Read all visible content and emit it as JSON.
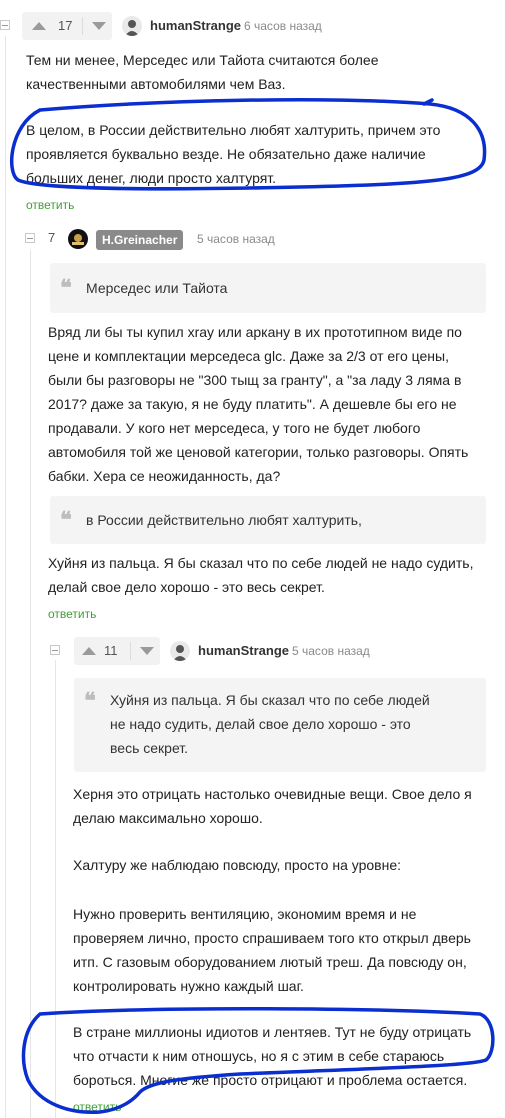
{
  "comment1": {
    "votes": "17",
    "username": "humanStrange",
    "time": "6 часов назад",
    "para1_l1": "Тем ни менее, Мерседес или Тайота считаются более",
    "para1_l2": "качественными автомобилями чем Ваз.",
    "para2_l1": "В целом, в России действительно любят халтурить, причем это",
    "para2_l2": "проявляется буквально везде. Не обязательно даже наличие",
    "para2_l3": "больших денег, люди просто халтурят.",
    "reply": "ответить"
  },
  "comment2": {
    "votes": "7",
    "username": "H.Greinacher",
    "time": "5 часов назад",
    "quote1": "Мерседес или Тайота",
    "body_l1": "Вряд ли бы ты купил xray или аркану в их прототипном виде по",
    "body_l2": "цене и комплектации мерседеса glc. Даже за 2/3 от его цены,",
    "body_l3": "были бы разговоры не \"300 тыщ за гранту\", а \"за ладу 3 ляма в",
    "body_l4": "2017? даже за такую, я не буду платить\". А дешевле бы его не",
    "body_l5": "продавали. У кого нет мерседеса, у того не будет любого",
    "body_l6": "автомобиля той же ценовой категории, только разговоры. Опять",
    "body_l7": "бабки. Хера се неожиданность, да?",
    "quote2": "в России действительно любят халтурить,",
    "tail_l1": "Хуйня из пальца. Я бы сказал что по себе людей не надо судить,",
    "tail_l2": "делай свое дело хорошо - это весь секрет.",
    "reply": "ответить"
  },
  "comment3": {
    "votes": "11",
    "username": "humanStrange",
    "time": "5 часов назад",
    "quote_l1": "Хуйня из пальца. Я бы сказал что по себе людей",
    "quote_l2": "не надо судить, делай свое дело хорошо - это",
    "quote_l3": "весь секрет.",
    "p1_l1": "Херня это отрицать настолько очевидные вещи. Свое дело я",
    "p1_l2": "делаю максимально хорошо.",
    "p2_l1": "Халтуру же наблюдаю повсюду, просто на уровне:",
    "p3_l1": "Нужно проверить вентиляцию, экономим время и не",
    "p3_l2": "проверяем лично, просто спрашиваем того кто открыл дверь",
    "p3_l3": "итп. С газовым оборудованием лютый треш. Да повсюду он,",
    "p3_l4": "контролировать нужно каждый шаг.",
    "p4_l1": "В стране миллионы идиотов и лентяев. Тут не буду отрицать",
    "p4_l2": "что отчасти к ним отношусь, но я с этим в себе стараюсь",
    "p4_l3": "бороться. Многие же просто отрицают и проблема остается.",
    "reply": "ответить"
  },
  "colors": {
    "annotation": "#0a2ecf",
    "reply_green": "#3e9f35"
  }
}
